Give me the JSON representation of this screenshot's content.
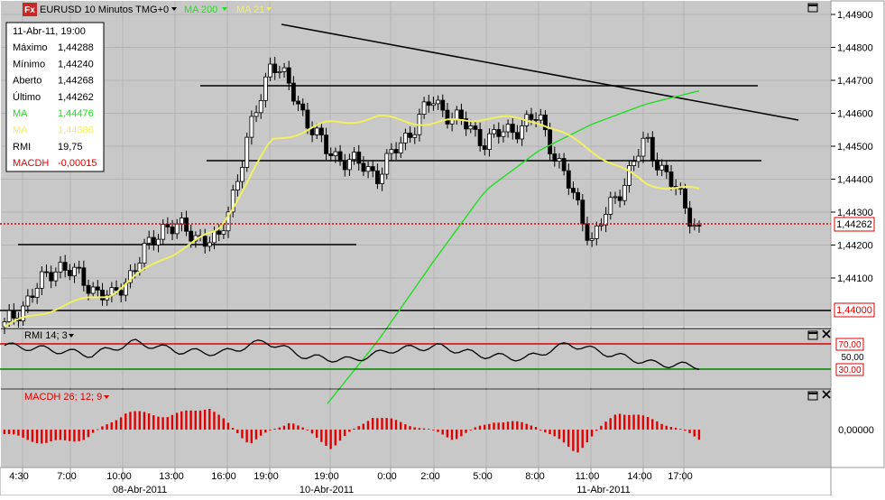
{
  "header": {
    "logo": "Fx",
    "symbol_label": "EURUSD 10 Minutos TMG+0",
    "ma200_label": "MA 200",
    "ma21_label": "MA 21",
    "dropdown_icon": "caret-down-icon"
  },
  "colors": {
    "background": "#c8c8c8",
    "candle_up": "#ffffff",
    "candle_down": "#000000",
    "ma200": "#22dd22",
    "ma21": "#f0f060",
    "last_price_line": "#e00000",
    "rmi_upper": "#e00000",
    "rmi_lower": "#008000",
    "macd_bars": "#e00000"
  },
  "info_box": {
    "date": "11-Abr-11, 19:00",
    "rows": [
      {
        "label": "Máximo",
        "value": "1,44288"
      },
      {
        "label": "Mínimo",
        "value": "1,44240"
      },
      {
        "label": "Aberto",
        "value": "1,44268"
      },
      {
        "label": "Último",
        "value": "1,44262"
      },
      {
        "label": "MA",
        "value": "1,44476"
      },
      {
        "label": "MA",
        "value": "1,44386"
      },
      {
        "label": "RMI",
        "value": "19,75"
      },
      {
        "label": "MACDH",
        "value": "-0,00015"
      }
    ]
  },
  "price_axis": {
    "ticks": [
      "1,44900",
      "1,44800",
      "1,44700",
      "1,44600",
      "1,44500",
      "1,44400",
      "1,44300",
      "1,44200",
      "1,44100"
    ],
    "last_price_label": "1,44262",
    "level_label": "1,44000"
  },
  "rmi_panel": {
    "label": "RMI 14; 3",
    "ticks": [
      "70,00",
      "50,00",
      "30,00"
    ]
  },
  "macd_panel": {
    "label": "MACDH 26; 12; 9",
    "ticks": [
      "0,00000"
    ]
  },
  "time_axis": {
    "hours": [
      "4:30",
      "7:00",
      "10:00",
      "13:00",
      "16:00",
      "19:00",
      "19:00",
      "0:00",
      "2:00",
      "5:00",
      "8:00",
      "11:00",
      "14:00",
      "17:00"
    ],
    "dates": [
      "08-Abr-2011",
      "10-Abr-2011",
      "11-Abr-2011"
    ]
  },
  "window_icons": {
    "maximize": "maximize-icon",
    "close": "close-icon"
  },
  "chart_data": {
    "type": "line",
    "symbol": "EURUSD",
    "interval": "10 Minutos",
    "grid": true,
    "price_ylim": [
      1.4399,
      1.4493
    ],
    "x": [
      "4:30",
      "7:00",
      "10:00",
      "13:00",
      "16:00",
      "19:00",
      "19:00",
      "0:00",
      "2:00",
      "5:00",
      "8:00",
      "11:00",
      "14:00",
      "17:00"
    ],
    "series": [
      {
        "name": "EURUSD",
        "values": [
          1.4399,
          1.4418,
          1.4407,
          1.443,
          1.4424,
          1.448,
          1.4452,
          1.4445,
          1.4467,
          1.4455,
          1.4462,
          1.4425,
          1.4455,
          1.4428
        ]
      },
      {
        "name": "MA 21",
        "values": [
          1.4399,
          1.4405,
          1.4409,
          1.442,
          1.4428,
          1.4455,
          1.446,
          1.4462,
          1.446,
          1.4462,
          1.4461,
          1.4452,
          1.4442,
          1.444
        ]
      },
      {
        "name": "MA 200",
        "values": [
          null,
          null,
          null,
          null,
          null,
          null,
          1.4375,
          1.4395,
          1.4418,
          1.444,
          1.4452,
          1.446,
          1.4466,
          1.447
        ]
      }
    ],
    "last_price": 1.44262,
    "horizontal_level": 1.44,
    "rmi": {
      "upper": 70,
      "mid": 50,
      "lower": 30,
      "values": [
        62,
        55,
        45,
        68,
        52,
        48,
        70,
        40,
        35,
        55,
        60,
        44,
        38,
        65,
        45,
        28,
        24
      ]
    },
    "macdh": {
      "zero": 0,
      "values": [
        -0.0001,
        -0.0003,
        -0.0002,
        0.0004,
        0.0003,
        0.0005,
        -0.0003,
        0.0002,
        -0.0004,
        0.0003,
        0.0001,
        -0.0002,
        0.0002,
        0.0001,
        -0.0005,
        0.0004,
        0.0002,
        -0.0002
      ]
    }
  }
}
